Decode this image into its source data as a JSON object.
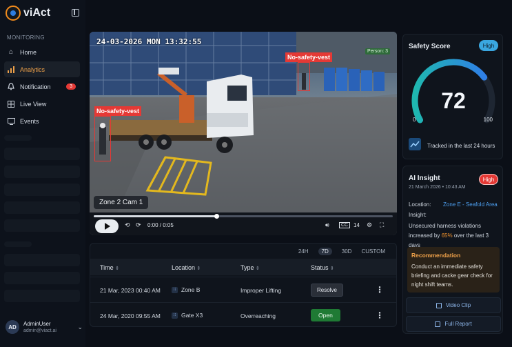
{
  "brand": {
    "name": "viAct"
  },
  "sidebar": {
    "section_label": "MONITORING",
    "items": [
      {
        "label": "Home",
        "icon": "home-icon"
      },
      {
        "label": "Analytics",
        "icon": "analytics-icon",
        "active": true
      },
      {
        "label": "Notification",
        "icon": "bell-icon",
        "badge": "3"
      },
      {
        "label": "Live View",
        "icon": "grid-icon"
      },
      {
        "label": "Events",
        "icon": "monitor-icon"
      }
    ]
  },
  "user": {
    "initials": "AD",
    "name": "AdminUser",
    "email": "admin@viact.ai"
  },
  "video": {
    "timestamp": "24-03-2026 MON 13:32:55",
    "detections": [
      {
        "label": "No-safety-vest"
      },
      {
        "label": "No-safety-vest"
      }
    ],
    "person_count": "Person: 3",
    "camera_label": "Zone 2 Cam 1",
    "time": "0:00 / 0:05",
    "progress": 0.41,
    "speed": "14"
  },
  "events": {
    "ranges": [
      "24H",
      "7D",
      "30D",
      "CUSTOM"
    ],
    "selected_range": "7D",
    "columns": [
      "Time",
      "Location",
      "Type",
      "Status"
    ],
    "rows": [
      {
        "time": "21 Mar, 2023 00:40 AM",
        "location": "Zone B",
        "type": "Improper Lifting",
        "status": "Resolve"
      },
      {
        "time": "24 Mar, 2020 09:55 AM",
        "location": "Gate X3",
        "type": "Overreaching",
        "status": "Open"
      }
    ]
  },
  "safety_score": {
    "title": "Safety Score",
    "level": "High",
    "value": 72,
    "min": "0",
    "max": "100",
    "tracked": "Tracked in the last 24 hours",
    "colors": {
      "start": "#1fb8b0",
      "end": "#2f7fe6"
    }
  },
  "insight": {
    "title": "AI Insight",
    "level": "High",
    "date": "21 March 2026 • 10:43 AM",
    "location_label": "Location:",
    "location_value": "Zone E - Seafold Area",
    "insight_label": "Insight:",
    "insight_pre": "Unsecured harness violations increased by ",
    "insight_highlight": "65%",
    "insight_post": " over the last 3 days",
    "recommendation_title": "Recommendation",
    "recommendation_text": "Conduct an immediate safety briefing and cacke gear check for night shift teams.",
    "actions": [
      "Video Clip",
      "Full Report"
    ]
  }
}
